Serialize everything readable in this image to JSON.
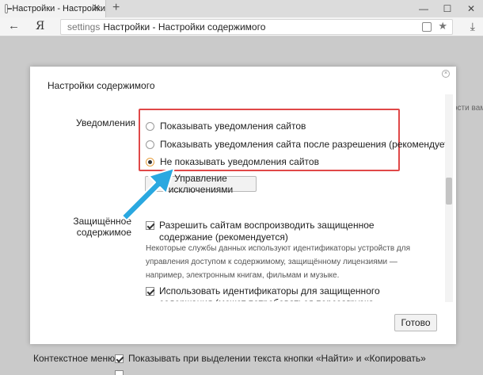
{
  "browser": {
    "tab_title": "Настройки - Настройки",
    "tab_close": "✕",
    "new_tab": "+",
    "win_min": "—",
    "win_max": "☐",
    "win_close": "✕",
    "back": "←",
    "logo": "Я",
    "address_prefix": "settings",
    "address_text": "Настройки - Настройки содержимого",
    "star": "★",
    "download": "⤓"
  },
  "background": {
    "right_text": "ости вам",
    "context_menu_label": "Контекстное меню",
    "context_menu_option": "Показывать при выделении текста кнопки «Найти» и «Копировать»"
  },
  "dialog": {
    "title": "Настройки содержимого",
    "close": "×",
    "notifications": {
      "label": "Уведомления",
      "options": [
        {
          "label": "Показывать уведомления сайтов",
          "checked": false
        },
        {
          "label": "Показывать уведомления сайта после разрешения (рекомендуется)",
          "checked": false
        },
        {
          "label": "Не показывать уведомления сайтов",
          "checked": true
        }
      ],
      "exceptions_button": "Управление исключениями"
    },
    "protected_content": {
      "label": "Защищённое содержимое",
      "allow_label": "Разрешить сайтам воспроизводить защищенное содержание (рекомендуется)",
      "allow_checked": true,
      "description": "Некоторые службы данных используют идентификаторы устройств для управления доступом к содержимому, защищённому лицензиями — например, электронным книгам, фильмам и музыке.",
      "ids_label": "Использовать идентификаторы для защищенного содержания (может потребоваться перезагрузка компьютера)",
      "ids_checked": true
    },
    "done_button": "Готово"
  },
  "colors": {
    "highlight_box": "#e04848",
    "arrow": "#2aa8e0",
    "selected_radio_ring": "#e8a040"
  }
}
